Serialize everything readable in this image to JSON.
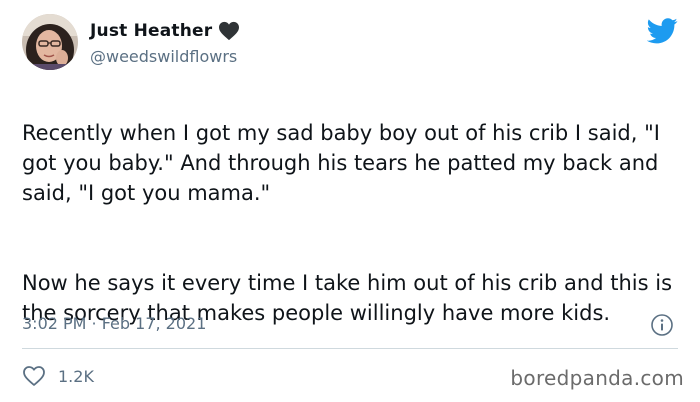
{
  "author": {
    "display_name": "Just Heather",
    "handle": "@weedswildflowrs",
    "name_emoji_icon": "black-heart-icon"
  },
  "tweet": {
    "paragraphs": [
      "Recently when I got my sad baby boy out of his crib I said, \"I got you baby.\" And through his tears he patted my back and said, \"I got you mama.\"",
      "Now he says it every time I take him out of his crib and this is the sorcery that makes people willingly have more kids."
    ],
    "timestamp": "3:02 PM · Feb 17, 2021",
    "like_count": "1.2K"
  },
  "icons": {
    "brand": "twitter-bird-icon",
    "info": "info-icon",
    "like": "heart-outline-icon"
  },
  "watermark": "boredpanda.com",
  "colors": {
    "twitter_blue": "#1d9bf0",
    "text_primary": "#0f1419",
    "text_secondary": "#5b7083",
    "divider": "#cfd9de"
  }
}
